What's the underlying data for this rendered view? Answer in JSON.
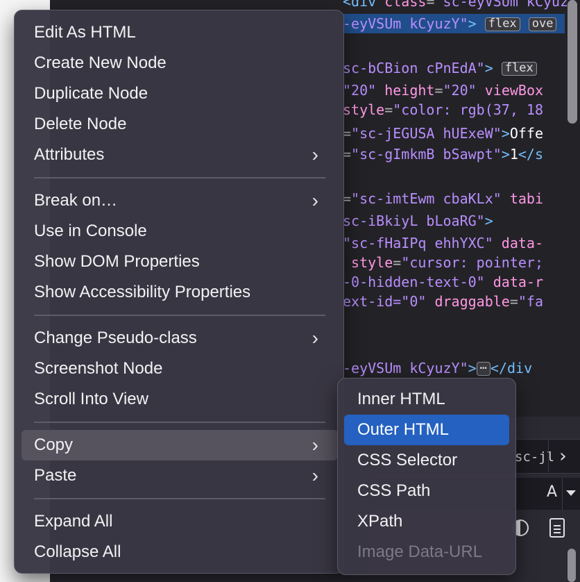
{
  "code": {
    "lines": [
      {
        "html": "<span class=\"tn\">&lt;div</span> <span class=\"an\">class</span>=<span class=\"av\">\"sc-eyVSUm kCyuzY\"</span><span class=\"tn\">&gt;</span>"
      },
      {
        "html": "<span class=\"av\">-eyVSUm kCyuzY\"</span><span class=\"tn\">&gt;</span> <span class=\"badge\">flex</span> <span class=\"badge\">ove</span>"
      },
      {
        "html": ""
      },
      {
        "html": "<span class=\"av\">sc-bCBion cPnEdA\"</span><span class=\"tn\">&gt;</span> <span class=\"badge\">flex</span>"
      },
      {
        "html": "<span class=\"av\">\"20\"</span> <span class=\"an\">height</span>=<span class=\"av\">\"20\"</span> <span class=\"an\">viewBox</span>"
      },
      {
        "html": "<span class=\"an\">style</span>=<span class=\"av\">\"color: rgb(37, 18</span>"
      },
      {
        "html": "=<span class=\"av\">\"sc-jEGUSA hUExeW\"</span><span class=\"tn\">&gt;</span><span class=\"txt\">Offe</span>"
      },
      {
        "html": "=<span class=\"av\">\"sc-gImkmB bSawpt\"</span><span class=\"tn\">&gt;</span><span class=\"txt\">1</span><span class=\"tn\">&lt;/s</span>"
      },
      {
        "html": ""
      },
      {
        "html": "=<span class=\"av\">\"sc-imtEwm cbaKLx\"</span> <span class=\"an\">tabi</span>"
      },
      {
        "html": "<span class=\"av\">sc-iBkiyL bLoaRG\"</span><span class=\"tn\">&gt;</span>"
      },
      {
        "html": "<span class=\"av\">\"sc-fHaIPq ehhYXC\"</span> <span class=\"an\">data-</span>"
      },
      {
        "html": " <span class=\"an\">style</span>=<span class=\"av\">\"cursor: pointer;</span>"
      },
      {
        "html": "<span class=\"av\">-0-hidden-text-0\"</span> <span class=\"an\">data-r</span>"
      },
      {
        "html": "<span class=\"av\">ext-id=\"0\"</span> <span class=\"an\">draggable</span>=<span class=\"av\">\"fa</span>"
      },
      {
        "html": ""
      },
      {
        "html": ""
      },
      {
        "html": ""
      },
      {
        "html": "<span class=\"av\">-eyVSUm kCyuzY\"</span><span class=\"tn\">&gt;</span><span class=\"badge\">⋯</span><span class=\"tn\">&lt;/div</span>"
      }
    ]
  },
  "bottom_panel": {
    "breadcrumb": "sc-jl",
    "font_label": "A"
  },
  "context_menu": {
    "items": [
      {
        "label": "Edit As HTML"
      },
      {
        "label": "Create New Node"
      },
      {
        "label": "Duplicate Node"
      },
      {
        "label": "Delete Node"
      },
      {
        "label": "Attributes",
        "submenu": true
      },
      {
        "label": "Break on…",
        "submenu": true
      },
      {
        "label": "Use in Console"
      },
      {
        "label": "Show DOM Properties"
      },
      {
        "label": "Show Accessibility Properties"
      },
      {
        "label": "Change Pseudo-class",
        "submenu": true
      },
      {
        "label": "Screenshot Node"
      },
      {
        "label": "Scroll Into View"
      },
      {
        "label": "Copy",
        "submenu": true,
        "active": true
      },
      {
        "label": "Paste",
        "submenu": true
      },
      {
        "label": "Expand All"
      },
      {
        "label": "Collapse All"
      }
    ]
  },
  "copy_submenu": {
    "items": [
      {
        "label": "Inner HTML"
      },
      {
        "label": "Outer HTML",
        "highlighted": true
      },
      {
        "label": "CSS Selector"
      },
      {
        "label": "CSS Path"
      },
      {
        "label": "XPath"
      },
      {
        "label": "Image Data-URL",
        "disabled": true
      }
    ]
  },
  "colors": {
    "selection": "#2461c0",
    "menu_bg": "#3a3744",
    "tag": "#75bfff",
    "attr_name": "#ff97e5",
    "attr_value": "#b98eff"
  },
  "icons": {
    "submenu_chevron": "chevron-right-icon",
    "breadcrumb_next": "chevron-right-icon",
    "contrast": "contrast-icon",
    "document": "document-icon",
    "dropdown": "triangle-down-icon"
  }
}
